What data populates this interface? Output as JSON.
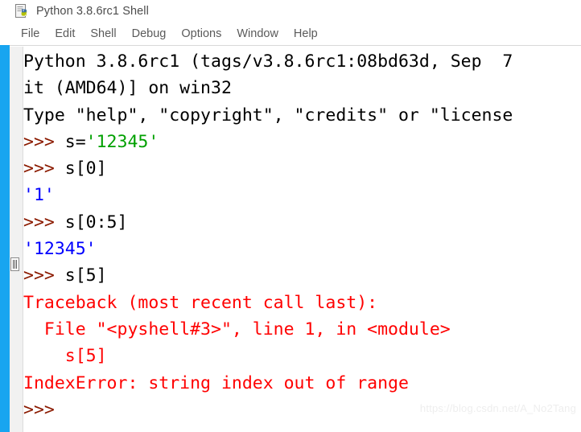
{
  "window": {
    "title": "Python 3.8.6rc1 Shell",
    "icon": "idle-python-icon"
  },
  "menubar": {
    "items": [
      {
        "label": "File"
      },
      {
        "label": "Edit"
      },
      {
        "label": "Shell"
      },
      {
        "label": "Debug"
      },
      {
        "label": "Options"
      },
      {
        "label": "Window"
      },
      {
        "label": "Help"
      }
    ]
  },
  "colors": {
    "prompt": "#8b1a00",
    "string": "#00a000",
    "output": "#0000ff",
    "error": "#ff0000",
    "accent_strip": "#18a5f0",
    "text": "#000000"
  },
  "console": {
    "lines": [
      {
        "name": "banner-line-1",
        "segments": [
          {
            "text": "Python 3.8.6rc1 (tags/v3.8.6rc1:08bd63d, Sep  7",
            "color": "black"
          }
        ]
      },
      {
        "name": "banner-line-2",
        "segments": [
          {
            "text": "it (AMD64)] on win32",
            "color": "black"
          }
        ]
      },
      {
        "name": "banner-line-3",
        "segments": [
          {
            "text": "Type \"help\", \"copyright\", \"credits\" or \"license",
            "color": "black"
          }
        ]
      },
      {
        "name": "input-line-assign",
        "segments": [
          {
            "text": ">>> ",
            "color": "prompt"
          },
          {
            "text": "s=",
            "color": "black"
          },
          {
            "text": "'12345'",
            "color": "string"
          }
        ]
      },
      {
        "name": "input-line-index-0",
        "segments": [
          {
            "text": ">>> ",
            "color": "prompt"
          },
          {
            "text": "s[0]",
            "color": "black"
          }
        ]
      },
      {
        "name": "output-line-index-0",
        "segments": [
          {
            "text": "'1'",
            "color": "output"
          }
        ]
      },
      {
        "name": "input-line-slice",
        "segments": [
          {
            "text": ">>> ",
            "color": "prompt"
          },
          {
            "text": "s[0:5]",
            "color": "black"
          }
        ]
      },
      {
        "name": "output-line-slice",
        "segments": [
          {
            "text": "'12345'",
            "color": "output"
          }
        ]
      },
      {
        "name": "input-line-index-5",
        "segments": [
          {
            "text": ">>> ",
            "color": "prompt"
          },
          {
            "text": "s[5]",
            "color": "black"
          }
        ]
      },
      {
        "name": "traceback-header",
        "segments": [
          {
            "text": "Traceback (most recent call last):",
            "color": "error"
          }
        ]
      },
      {
        "name": "traceback-file-line",
        "segments": [
          {
            "text": "  File \"<pyshell#3>\", line 1, in <module>",
            "color": "error"
          }
        ]
      },
      {
        "name": "traceback-source-line",
        "segments": [
          {
            "text": "    s[5]",
            "color": "error"
          }
        ]
      },
      {
        "name": "traceback-exception",
        "segments": [
          {
            "text": "IndexError: string index out of range",
            "color": "error"
          }
        ]
      },
      {
        "name": "input-line-empty-prompt",
        "segments": [
          {
            "text": ">>>",
            "color": "prompt"
          }
        ]
      }
    ]
  },
  "watermark": {
    "text": "https://blog.csdn.net/A_No2Tang"
  }
}
